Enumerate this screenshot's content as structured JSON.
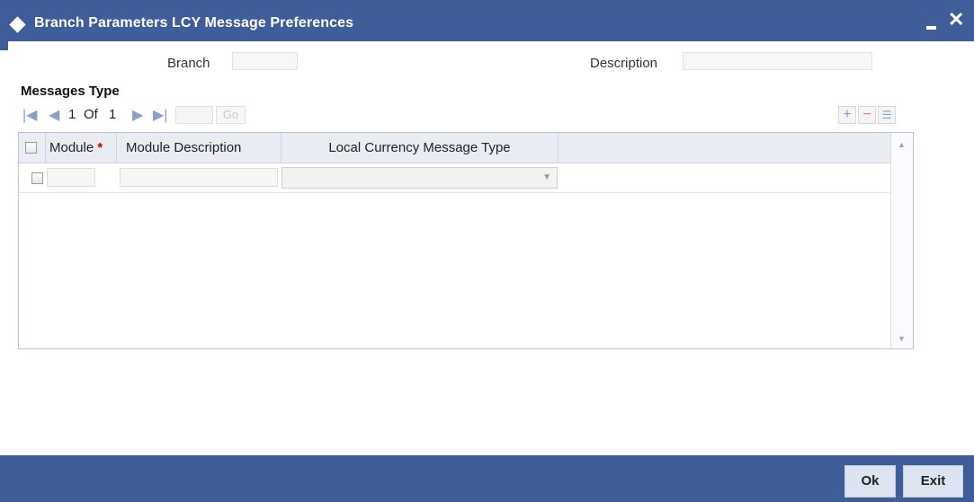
{
  "window": {
    "title": "Branch Parameters LCY Message Preferences",
    "minimize_label": "–",
    "close_label": "✕"
  },
  "form": {
    "branch_label": "Branch",
    "branch_value": "",
    "description_label": "Description",
    "description_value": ""
  },
  "messages": {
    "section_title": "Messages Type",
    "pagination": {
      "current_page": "1",
      "of_label": "Of",
      "total_pages": "1",
      "page_input_value": "",
      "go_label": "Go"
    },
    "columns": {
      "module": "Module",
      "module_required_mark": "*",
      "module_description": "Module Description",
      "lcy_message_type": "Local Currency Message Type"
    },
    "rows": [
      {
        "module": "",
        "module_description": "",
        "lcy_message_type": ""
      }
    ]
  },
  "footer": {
    "ok_label": "Ok",
    "exit_label": "Exit"
  },
  "colors": {
    "titlebar": "#3e5d99",
    "footer": "#3e5d99",
    "required": "#cc0000",
    "button_bg": "#dce4f1"
  },
  "icons": {
    "title": "diamond-icon",
    "first": "first-page-icon",
    "prev": "prev-page-icon",
    "next": "next-page-icon",
    "last": "last-page-icon",
    "add": "add-row-icon",
    "delete": "delete-row-icon",
    "single_view": "single-view-icon",
    "dropdown": "chevron-down-icon"
  }
}
